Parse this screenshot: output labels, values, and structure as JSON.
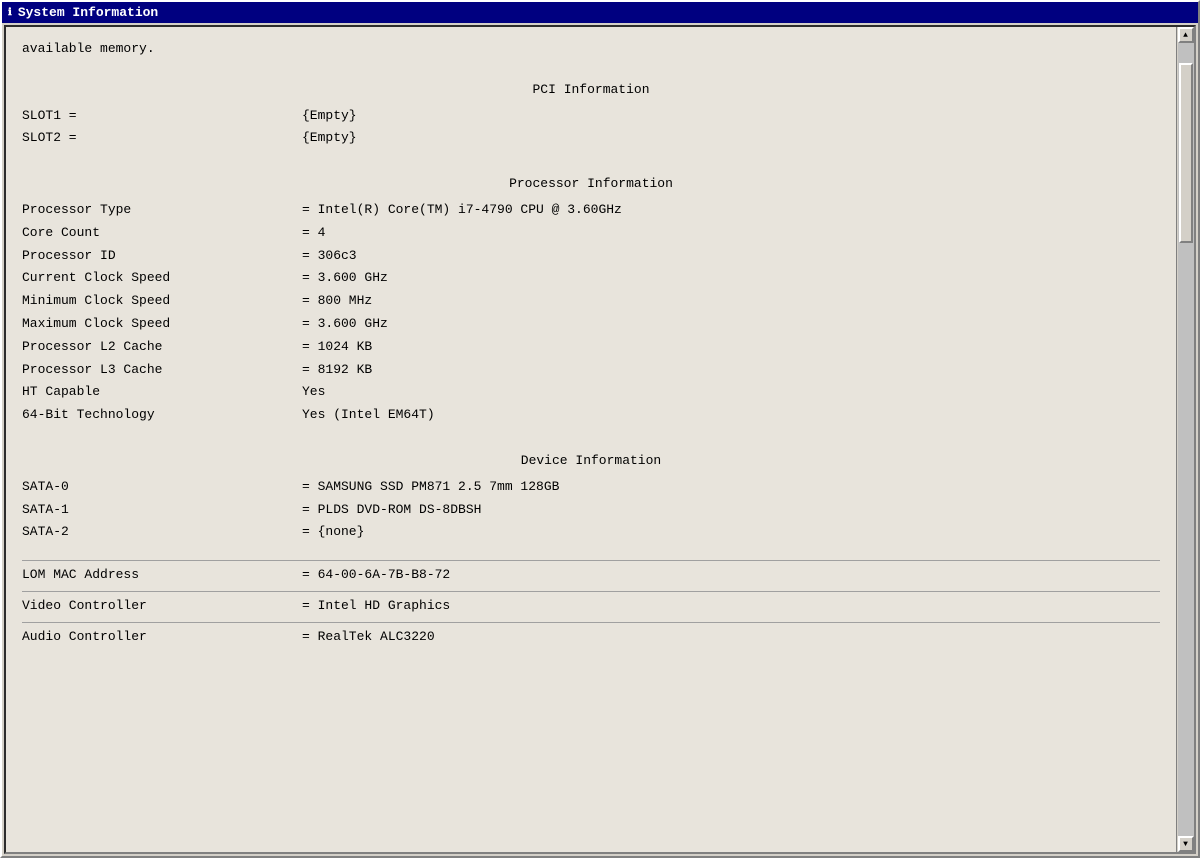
{
  "window": {
    "title": "System Information"
  },
  "content": {
    "intro_text": "available memory.",
    "pci_section": {
      "header": "PCI Information",
      "rows": [
        {
          "label": "SLOT1 =",
          "value": "{Empty}"
        },
        {
          "label": "SLOT2 =",
          "value": "{Empty}"
        }
      ]
    },
    "processor_section": {
      "header": "Processor Information",
      "rows": [
        {
          "label": "Processor Type",
          "value": "= Intel(R) Core(TM) i7-4790 CPU @ 3.60GHz"
        },
        {
          "label": "Core Count",
          "value": "= 4"
        },
        {
          "label": "Processor ID",
          "value": "= 306c3"
        },
        {
          "label": "Current Clock Speed",
          "value": "= 3.600 GHz"
        },
        {
          "label": "Minimum Clock Speed",
          "value": "= 800 MHz"
        },
        {
          "label": "Maximum Clock Speed",
          "value": "= 3.600 GHz"
        },
        {
          "label": "Processor L2 Cache",
          "value": "= 1024 KB"
        },
        {
          "label": "Processor L3 Cache",
          "value": "= 8192 KB"
        },
        {
          "label": "HT Capable",
          "value": "Yes"
        },
        {
          "label": "64-Bit Technology",
          "value": "Yes (Intel EM64T)"
        }
      ]
    },
    "device_section": {
      "header": "Device Information",
      "rows": [
        {
          "label": "SATA-0",
          "value": "= SAMSUNG SSD PM871 2.5 7mm 128GB"
        },
        {
          "label": "SATA-1",
          "value": "= PLDS DVD-ROM DS-8DBSH"
        },
        {
          "label": "SATA-2",
          "value": "= {none}"
        }
      ]
    },
    "network_section": {
      "rows": [
        {
          "label": "LOM MAC Address",
          "value": "= 64-00-6A-7B-B8-72",
          "border": true
        }
      ]
    },
    "video_section": {
      "rows": [
        {
          "label": "Video Controller",
          "value": "= Intel HD Graphics",
          "border": true
        }
      ]
    },
    "audio_section": {
      "rows": [
        {
          "label": "Audio Controller",
          "value": "= RealTek ALC3220",
          "border": true
        }
      ]
    }
  },
  "scrollbar": {
    "up_arrow": "▲",
    "down_arrow": "▼"
  }
}
